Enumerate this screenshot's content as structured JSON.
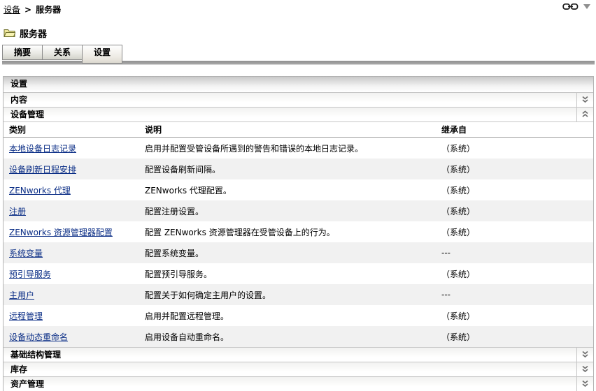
{
  "breadcrumb": {
    "root_label": "设备",
    "separator": ">",
    "current_label": "服务器"
  },
  "page": {
    "title": "服务器",
    "title_icon": "folder-icon"
  },
  "toolbar_icons": {
    "link_icon": "chain-link-icon",
    "menu_icon": "dropdown-arrow-icon"
  },
  "tabs": [
    {
      "label": "摘要",
      "active": false
    },
    {
      "label": "关系",
      "active": false
    },
    {
      "label": "设置",
      "active": true
    }
  ],
  "panel": {
    "title": "设置",
    "sections_top": [
      {
        "label": "内容",
        "state": "collapsed"
      },
      {
        "label": "设备管理",
        "state": "expanded"
      }
    ],
    "table": {
      "columns": [
        "类别",
        "说明",
        "继承自"
      ],
      "rows": [
        {
          "category": "本地设备日志记录",
          "description": "启用并配置受管设备所遇到的警告和错误的本地日志记录。",
          "inherited": "（系统）"
        },
        {
          "category": "设备刷新日程安排",
          "description": "配置设备刷新间隔。",
          "inherited": "（系统）"
        },
        {
          "category": "ZENworks 代理",
          "description": "ZENworks 代理配置。",
          "inherited": "（系统）"
        },
        {
          "category": "注册",
          "description": "配置注册设置。",
          "inherited": "（系统）"
        },
        {
          "category": "ZENworks 资源管理器配置",
          "description": "配置 ZENworks 资源管理器在受管设备上的行为。",
          "inherited": "（系统）"
        },
        {
          "category": "系统变量",
          "description": "配置系统变量。",
          "inherited": "---"
        },
        {
          "category": "预引导服务",
          "description": "配置预引导服务。",
          "inherited": "（系统）"
        },
        {
          "category": "主用户",
          "description": "配置关于如何确定主用户的设置。",
          "inherited": "---"
        },
        {
          "category": "远程管理",
          "description": "启用并配置远程管理。",
          "inherited": "（系统）"
        },
        {
          "category": "设备动态重命名",
          "description": "启用设备自动重命名。",
          "inherited": "（系统）"
        }
      ]
    },
    "sections_bottom": [
      {
        "label": "基础结构管理",
        "state": "collapsed"
      },
      {
        "label": "库存",
        "state": "collapsed"
      },
      {
        "label": "资产管理",
        "state": "collapsed"
      }
    ]
  },
  "colors": {
    "link": "#0b2e86",
    "row_alt": "#f1f1f1",
    "tab_strip": "#9c9c9c",
    "panel_border": "#b3b3b3"
  }
}
